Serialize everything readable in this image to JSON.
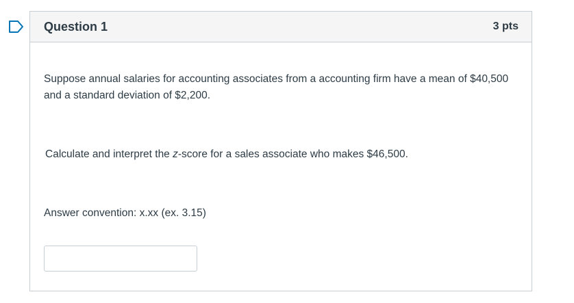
{
  "question": {
    "title": "Question 1",
    "points": "3 pts",
    "paragraph1": "Suppose annual salaries for accounting associates from a accounting firm have a mean of $40,500 and a standard deviation of $2,200.",
    "paragraph2_before": "Calculate and interpret the ",
    "paragraph2_emph": "z",
    "paragraph2_after": "-score for a sales associate who makes $46,500.",
    "paragraph3": "Answer convention: x.xx  (ex. 3.15)",
    "answer_value": ""
  },
  "icons": {
    "flag": "flag-icon"
  },
  "colors": {
    "border": "#c7cdd1",
    "header_bg": "#f5f5f5",
    "text": "#2d3b45",
    "flag": "#0374b5"
  }
}
